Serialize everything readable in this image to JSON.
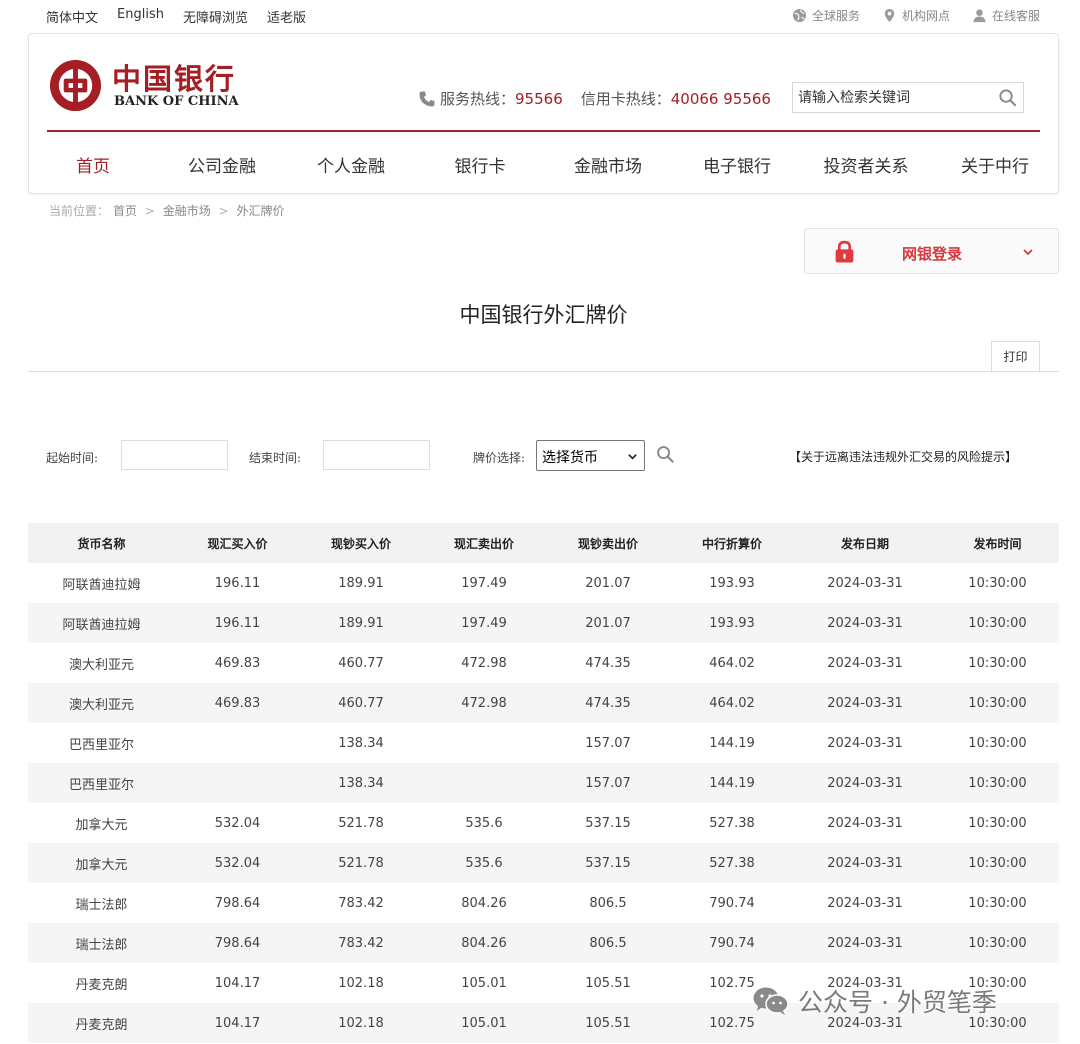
{
  "topbar": {
    "lang_links": [
      "简体中文",
      "English",
      "无障碍浏览",
      "适老版"
    ],
    "services": [
      {
        "label": "全球服务",
        "icon": "globe-icon"
      },
      {
        "label": "机构网点",
        "icon": "location-pin-icon"
      },
      {
        "label": "在线客服",
        "icon": "customer-service-icon"
      }
    ]
  },
  "header": {
    "logo_cn": "中国银行",
    "logo_en": "BANK OF CHINA",
    "service_hotline_label": "服务热线：",
    "service_hotline": "95566",
    "card_hotline_label": "信用卡热线：",
    "card_hotline": "40066 95566",
    "search_placeholder": "请输入检索关键词",
    "accent_color": "#a41e24"
  },
  "nav": {
    "items": [
      "首页",
      "公司金融",
      "个人金融",
      "银行卡",
      "金融市场",
      "电子银行",
      "投资者关系",
      "关于中行"
    ],
    "active_index": 0
  },
  "breadcrumb": {
    "prefix": "当前位置：",
    "items": [
      "首页",
      "金融市场",
      "外汇牌价"
    ],
    "separator": ">"
  },
  "login": {
    "label": "网银登录"
  },
  "page": {
    "title": "中国银行外汇牌价",
    "print_label": "打印"
  },
  "filter": {
    "start_label": "起始时间:",
    "end_label": "结束时间:",
    "currency_label": "牌价选择:",
    "currency_select": "选择货币",
    "risk_link": "【关于远离违法违规外汇交易的风险提示】"
  },
  "table": {
    "headers": [
      "货币名称",
      "现汇买入价",
      "现钞买入价",
      "现汇卖出价",
      "现钞卖出价",
      "中行折算价",
      "发布日期",
      "发布时间"
    ],
    "rows": [
      [
        "阿联酋迪拉姆",
        "196.11",
        "189.91",
        "197.49",
        "201.07",
        "193.93",
        "2024-03-31",
        "10:30:00"
      ],
      [
        "阿联酋迪拉姆",
        "196.11",
        "189.91",
        "197.49",
        "201.07",
        "193.93",
        "2024-03-31",
        "10:30:00"
      ],
      [
        "澳大利亚元",
        "469.83",
        "460.77",
        "472.98",
        "474.35",
        "464.02",
        "2024-03-31",
        "10:30:00"
      ],
      [
        "澳大利亚元",
        "469.83",
        "460.77",
        "472.98",
        "474.35",
        "464.02",
        "2024-03-31",
        "10:30:00"
      ],
      [
        "巴西里亚尔",
        "",
        "138.34",
        "",
        "157.07",
        "144.19",
        "2024-03-31",
        "10:30:00"
      ],
      [
        "巴西里亚尔",
        "",
        "138.34",
        "",
        "157.07",
        "144.19",
        "2024-03-31",
        "10:30:00"
      ],
      [
        "加拿大元",
        "532.04",
        "521.78",
        "535.6",
        "537.15",
        "527.38",
        "2024-03-31",
        "10:30:00"
      ],
      [
        "加拿大元",
        "532.04",
        "521.78",
        "535.6",
        "537.15",
        "527.38",
        "2024-03-31",
        "10:30:00"
      ],
      [
        "瑞士法郎",
        "798.64",
        "783.42",
        "804.26",
        "806.5",
        "790.74",
        "2024-03-31",
        "10:30:00"
      ],
      [
        "瑞士法郎",
        "798.64",
        "783.42",
        "804.26",
        "806.5",
        "790.74",
        "2024-03-31",
        "10:30:00"
      ],
      [
        "丹麦克朗",
        "104.17",
        "102.18",
        "105.01",
        "105.51",
        "102.75",
        "2024-03-31",
        "10:30:00"
      ],
      [
        "丹麦克朗",
        "104.17",
        "102.18",
        "105.01",
        "105.51",
        "102.75",
        "2024-03-31",
        "10:30:00"
      ]
    ]
  },
  "watermark": {
    "text": "公众号 · 外贸笔季",
    "icon": "wechat-icon"
  }
}
